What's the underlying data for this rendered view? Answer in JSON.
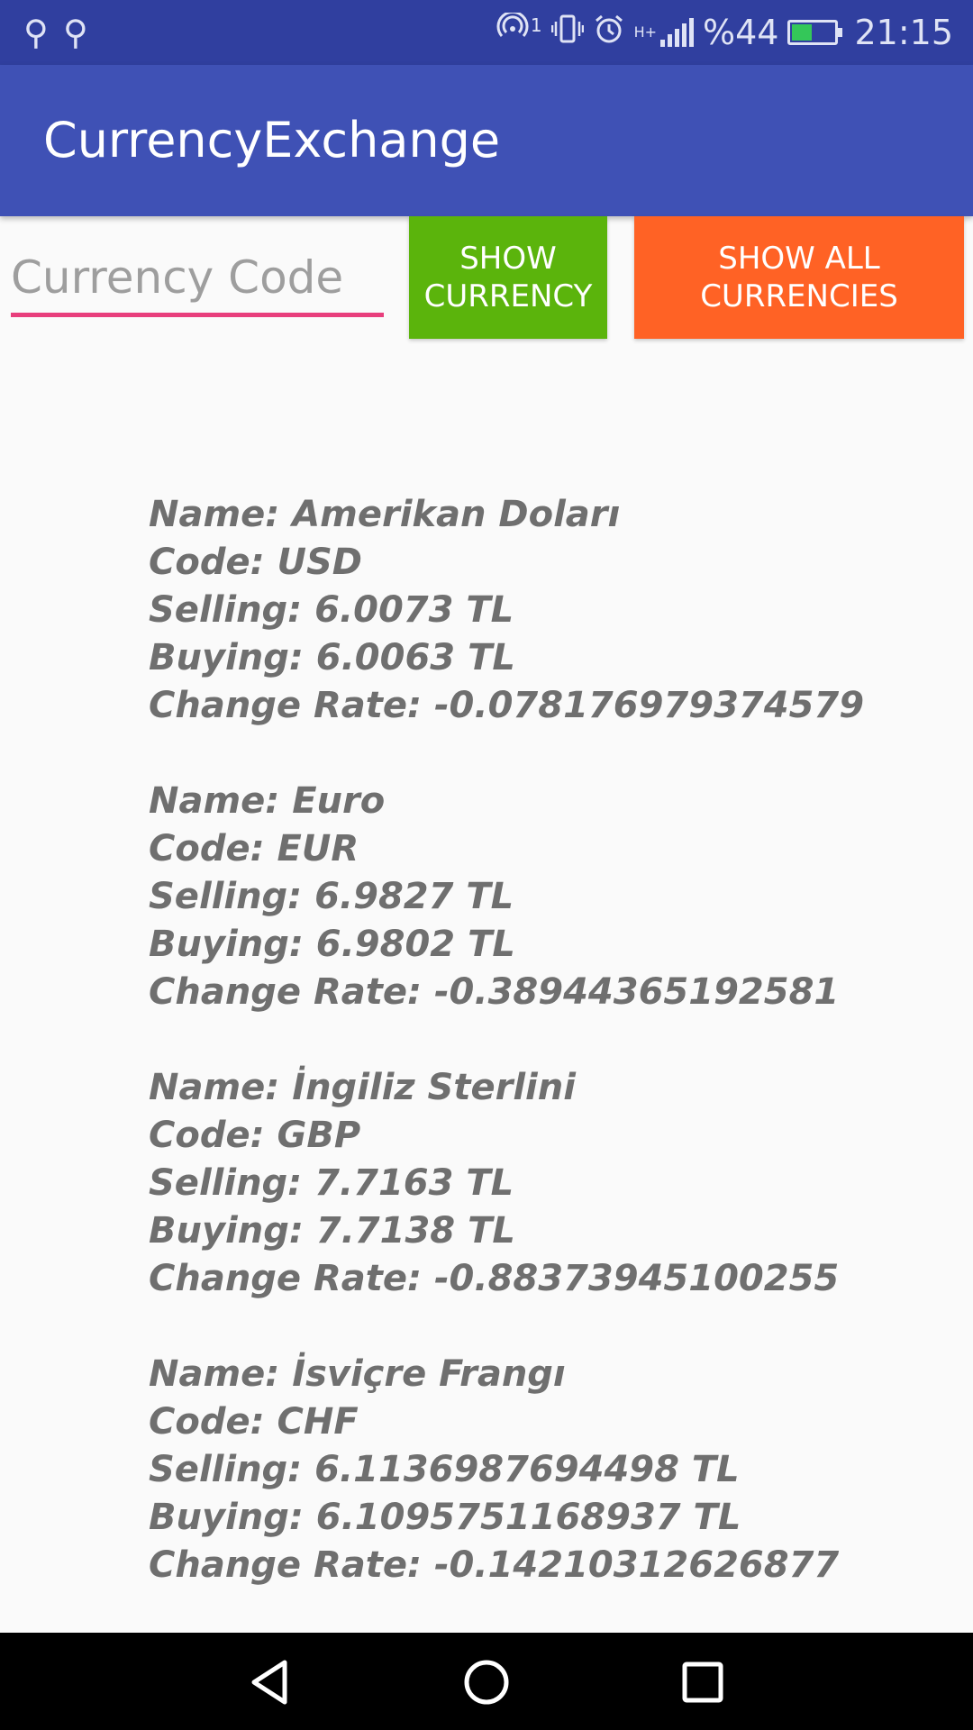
{
  "status_bar": {
    "icons": [
      "usb-icon",
      "usb-icon",
      "hotspot-icon",
      "vibrate-icon",
      "alarm-icon",
      "signal-icon",
      "battery-icon"
    ],
    "hotspot_count": "1",
    "network_type": "H+",
    "battery_text": "%44",
    "battery_level": 0.44,
    "time": "21:15"
  },
  "app_bar": {
    "title": "CurrencyExchange"
  },
  "search": {
    "placeholder": "Currency Code",
    "value": ""
  },
  "buttons": {
    "show_currency": "SHOW\nCURRENCY",
    "show_all": "SHOW ALL\nCURRENCIES"
  },
  "currencies": [
    {
      "name": "Name: Amerikan Doları",
      "code": "Code: USD",
      "selling": "Selling: 6.0073 TL",
      "buying": "Buying: 6.0063 TL",
      "change": "Change Rate: -0.078176979374579"
    },
    {
      "name": "Name: Euro",
      "code": "Code: EUR",
      "selling": "Selling: 6.9827 TL",
      "buying": "Buying: 6.9802 TL",
      "change": "Change Rate: -0.38944365192581"
    },
    {
      "name": "Name: İngiliz Sterlini",
      "code": "Code: GBP",
      "selling": "Selling: 7.7163 TL",
      "buying": "Buying: 7.7138 TL",
      "change": "Change Rate: -0.88373945100255"
    },
    {
      "name": "Name: İsviçre Frangı",
      "code": "Code: CHF",
      "selling": "Selling: 6.1136987694498 TL",
      "buying": "Buying: 6.1095751168937 TL",
      "change": "Change Rate: -0.14210312626877"
    }
  ],
  "nav_bar": {
    "icons": [
      "back-icon",
      "home-icon",
      "recents-icon"
    ]
  },
  "colors": {
    "status_bar": "#303f9f",
    "app_bar": "#3f51b5",
    "accent_underline": "#e83e7c",
    "show_currency_button": "#5bb40c",
    "show_all_button": "#ff6225",
    "result_text": "#6f6f6f"
  }
}
